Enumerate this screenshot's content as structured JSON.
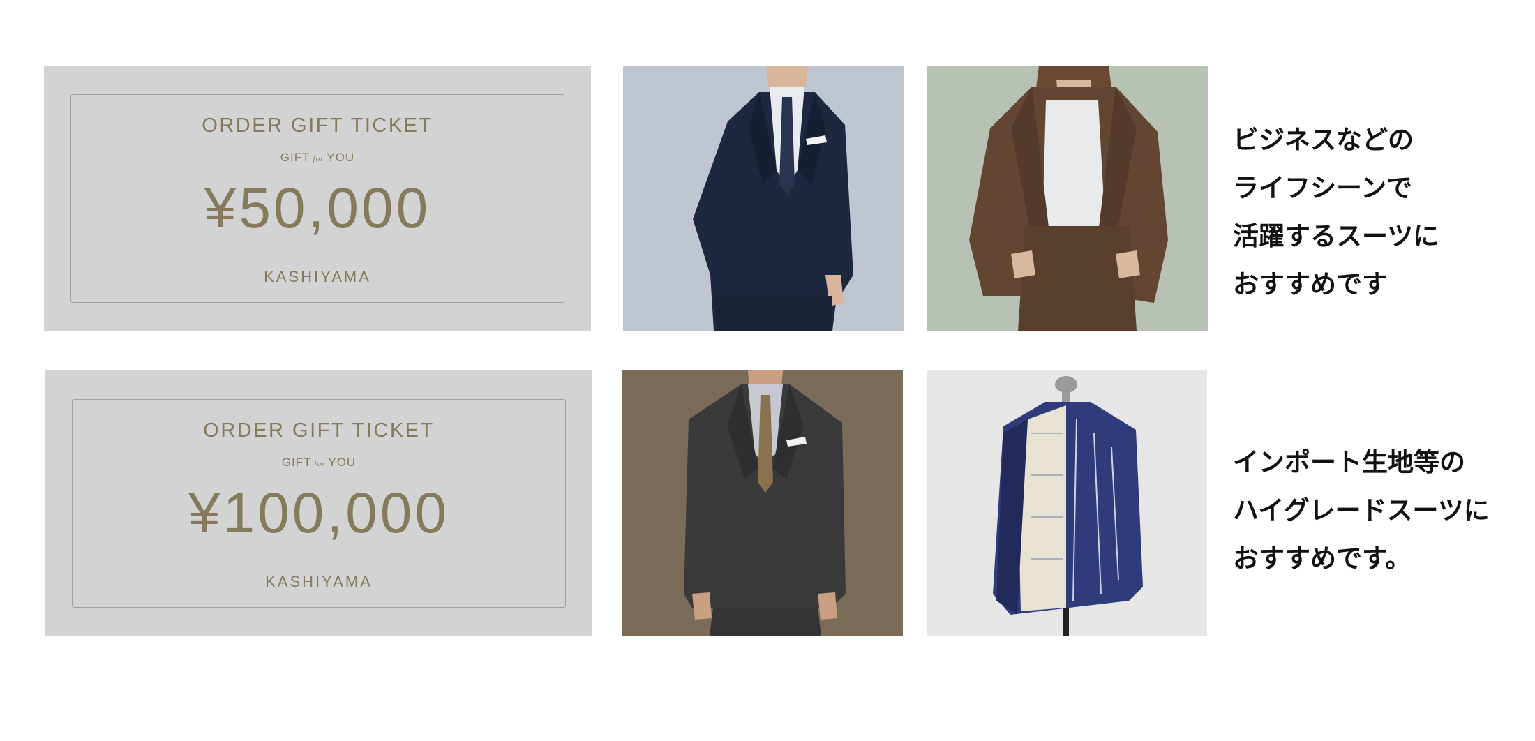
{
  "tickets": [
    {
      "title": "ORDER GIFT TICKET",
      "sub_left": "GIFT",
      "sub_mid": "for",
      "sub_right": "YOU",
      "amount": "¥50,000",
      "brand": "KASHIYAMA"
    },
    {
      "title": "ORDER GIFT TICKET",
      "sub_left": "GIFT",
      "sub_mid": "for",
      "sub_right": "YOU",
      "amount": "¥100,000",
      "brand": "KASHIYAMA"
    }
  ],
  "captions": [
    {
      "lines": [
        "ビジネスなどの",
        "ライフシーンで",
        "活躍するスーツに",
        "おすすめです"
      ]
    },
    {
      "lines": [
        "インポート生地等の",
        "ハイグレードスーツに",
        "おすすめです。"
      ]
    }
  ],
  "colors": {
    "ticket_bg": "#d3d3d3",
    "ticket_text": "#857a5c",
    "caption_text": "#111111"
  },
  "photos": [
    {
      "name": "man-navy-suit-photo"
    },
    {
      "name": "woman-brown-suit-photo"
    },
    {
      "name": "man-charcoal-suit-photo"
    },
    {
      "name": "tailored-jacket-mannequin-photo"
    }
  ]
}
